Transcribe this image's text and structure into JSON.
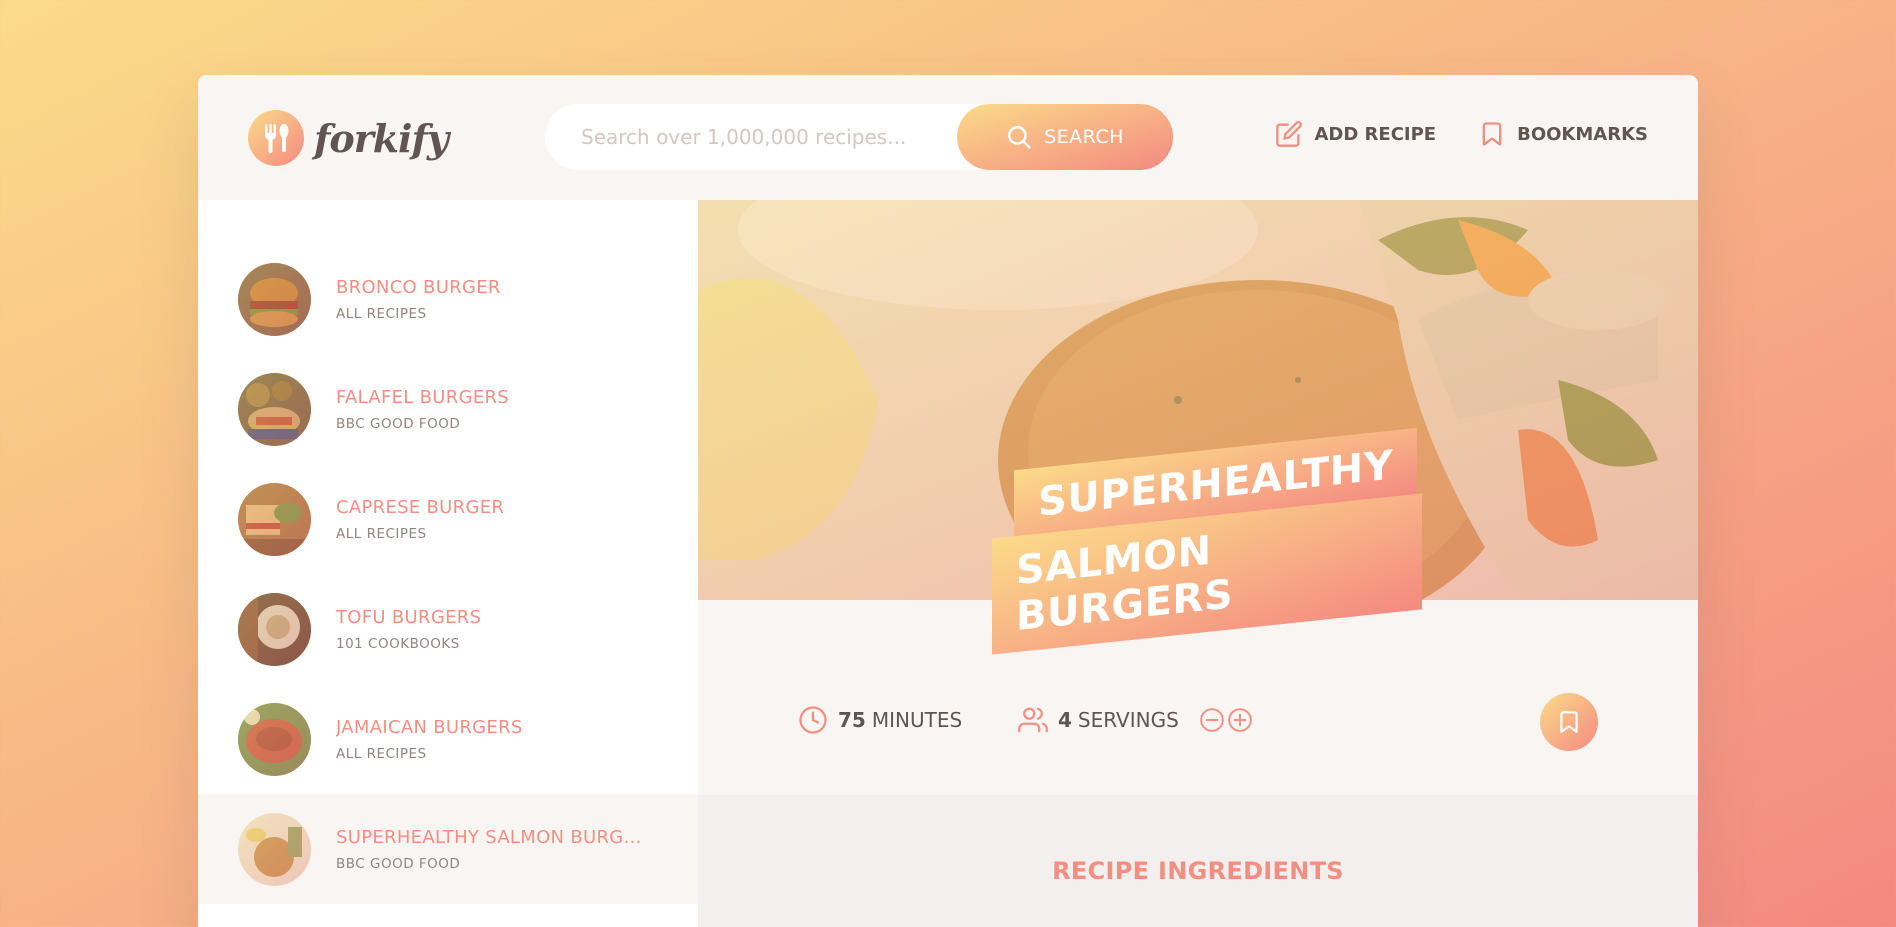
{
  "header": {
    "logo_text": "forkify",
    "search_placeholder": "Search over 1,000,000 recipes...",
    "search_label": "SEARCH",
    "nav": [
      {
        "label": "ADD RECIPE",
        "icon": "edit-icon"
      },
      {
        "label": "BOOKMARKS",
        "icon": "bookmark-icon"
      }
    ]
  },
  "results": [
    {
      "title": "BRONCO BURGER",
      "publisher": "ALL RECIPES"
    },
    {
      "title": "FALAFEL BURGERS",
      "publisher": "BBC GOOD FOOD"
    },
    {
      "title": "CAPRESE BURGER",
      "publisher": "ALL RECIPES"
    },
    {
      "title": "TOFU BURGERS",
      "publisher": "101 COOKBOOKS"
    },
    {
      "title": "JAMAICAN BURGERS",
      "publisher": "ALL RECIPES"
    },
    {
      "title": "SUPERHEALTHY SALMON BURGE...",
      "publisher": "BBC GOOD FOOD"
    }
  ],
  "recipe": {
    "title_line1": "SUPERHEALTHY",
    "title_line2": "SALMON BURGERS",
    "minutes": "75",
    "minutes_label": "MINUTES",
    "servings": "4",
    "servings_label": "SERVINGS",
    "ingredients_heading": "RECIPE INGREDIENTS"
  },
  "colors": {
    "gradient_start": "#fbdb89",
    "gradient_end": "#f48982",
    "accent": "#f38e82",
    "text": "#615551"
  }
}
